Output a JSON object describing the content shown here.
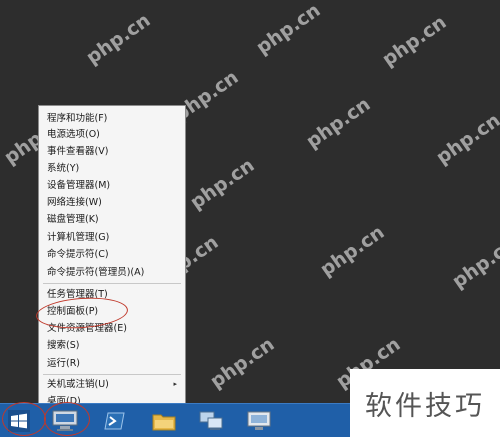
{
  "watermark": "php.cn",
  "menu": {
    "items": [
      {
        "label": "程序和功能(F)"
      },
      {
        "label": "电源选项(O)"
      },
      {
        "label": "事件查看器(V)"
      },
      {
        "label": "系统(Y)"
      },
      {
        "label": "设备管理器(M)"
      },
      {
        "label": "网络连接(W)"
      },
      {
        "label": "磁盘管理(K)"
      },
      {
        "label": "计算机管理(G)"
      },
      {
        "label": "命令提示符(C)"
      },
      {
        "label": "命令提示符(管理员)(A)"
      },
      {
        "label": "任务管理器(T)"
      },
      {
        "label": "控制面板(P)"
      },
      {
        "label": "文件资源管理器(E)"
      },
      {
        "label": "搜索(S)"
      },
      {
        "label": "运行(R)"
      },
      {
        "label": "关机或注销(U)"
      },
      {
        "label": "桌面(D)"
      }
    ],
    "submenu_arrow": "▸",
    "highlight_color": "#c0392b"
  },
  "overlay_text": "软件技巧",
  "colors": {
    "taskbar": "#1f5fa8",
    "desktop": "#2d2d2d"
  },
  "icons": [
    "windows-logo-icon",
    "server-manager-icon",
    "powershell-icon",
    "file-explorer-icon",
    "network-icon",
    "remote-desktop-icon"
  ]
}
